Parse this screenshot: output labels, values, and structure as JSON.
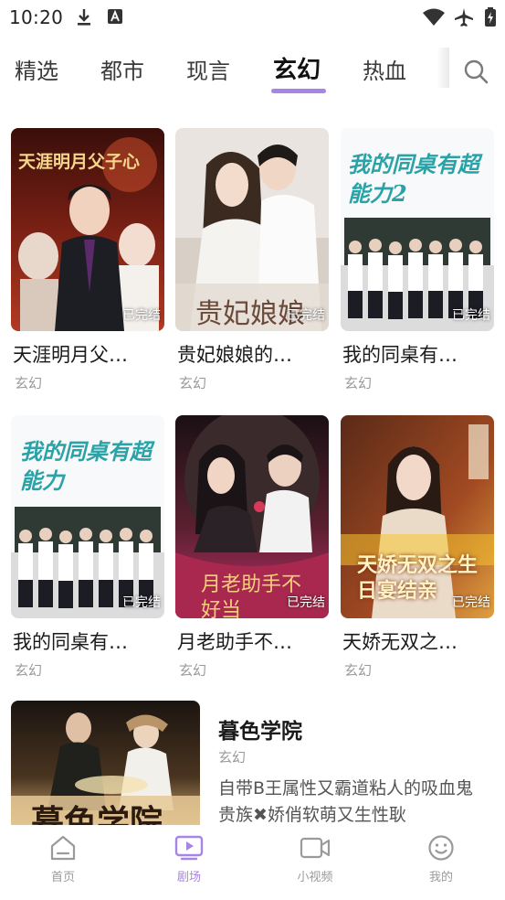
{
  "status_bar": {
    "time": "10:20"
  },
  "tabs": [
    {
      "label": "精选"
    },
    {
      "label": "都市"
    },
    {
      "label": "现言"
    },
    {
      "label": "玄幻"
    },
    {
      "label": "热血"
    }
  ],
  "accent_color": "#a883e8",
  "cards": [
    {
      "title": "天涯明月父…",
      "genre": "玄幻",
      "badge": "已完结",
      "poster_text": "天涯明月父子心"
    },
    {
      "title": "贵妃娘娘的…",
      "genre": "玄幻",
      "badge": "已完结",
      "poster_text": "贵妃娘娘"
    },
    {
      "title": "我的同桌有…",
      "genre": "玄幻",
      "badge": "已完结",
      "poster_text": "我的同桌有超能力2"
    },
    {
      "title": "我的同桌有…",
      "genre": "玄幻",
      "badge": "已完结",
      "poster_text": "我的同桌有超能力"
    },
    {
      "title": "月老助手不…",
      "genre": "玄幻",
      "badge": "已完结",
      "poster_text": "月老助手不好当"
    },
    {
      "title": "天娇无双之…",
      "genre": "玄幻",
      "badge": "已完结",
      "poster_text": "天娇无双之生日宴结亲"
    }
  ],
  "feature": {
    "title": "暮色学院",
    "genre": "玄幻",
    "description": "自带B王属性又霸道粘人的吸血鬼贵族✖娇俏软萌又生性耿",
    "poster_text": "暮色学院"
  },
  "bottom_nav": [
    {
      "label": "首页",
      "icon": "home-icon"
    },
    {
      "label": "剧场",
      "icon": "theater-play-icon"
    },
    {
      "label": "小视频",
      "icon": "video-camera-icon"
    },
    {
      "label": "我的",
      "icon": "smiley-profile-icon"
    }
  ]
}
